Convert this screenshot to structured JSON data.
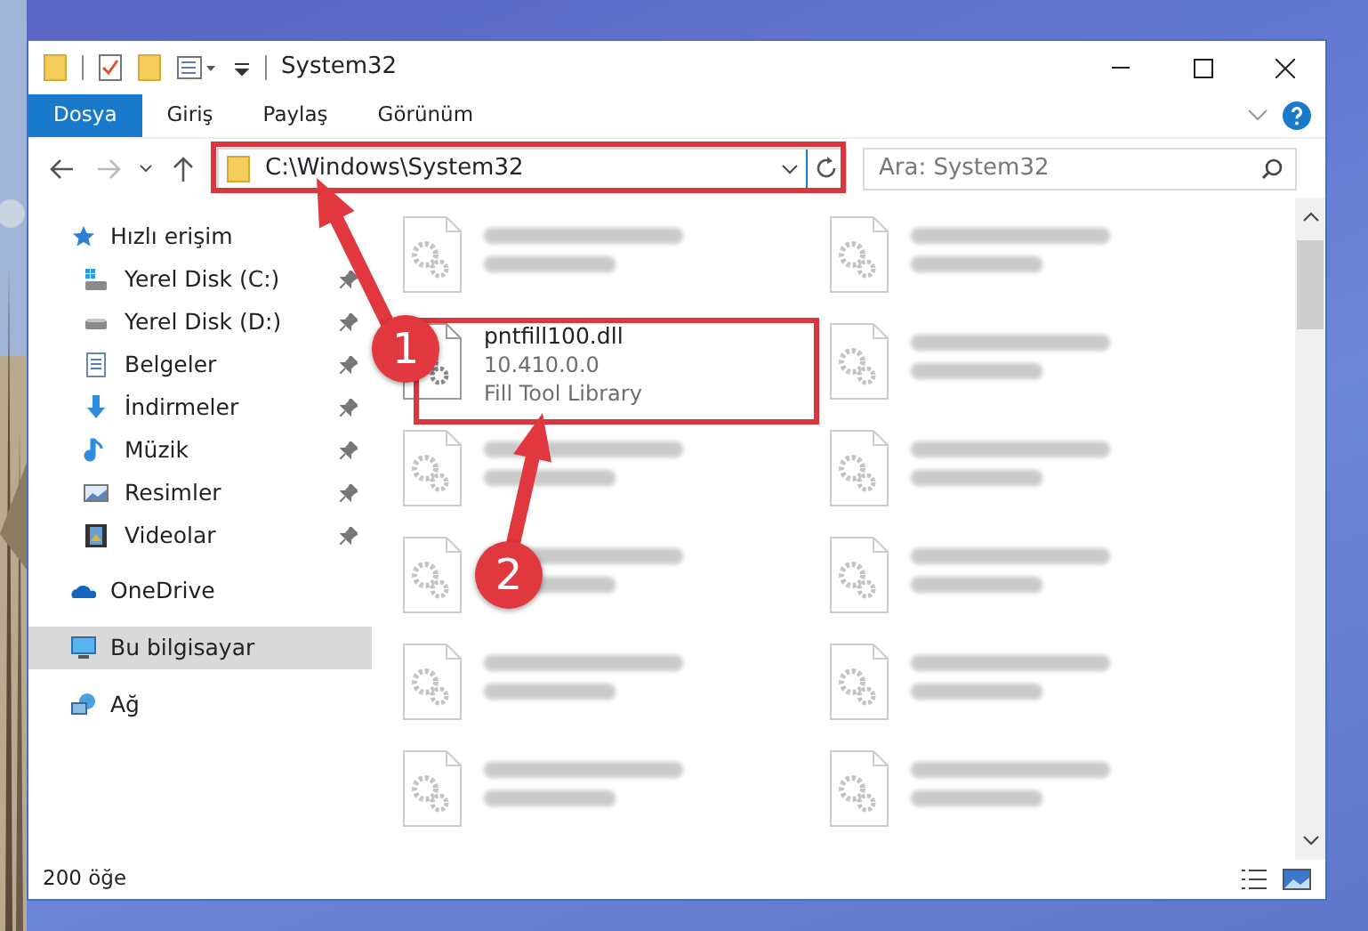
{
  "window": {
    "title": "System32"
  },
  "ribbon_tabs": [
    {
      "label": "Dosya",
      "kind": "file"
    },
    {
      "label": "Giriş",
      "kind": "tab"
    },
    {
      "label": "Paylaş",
      "kind": "tab"
    },
    {
      "label": "Görünüm",
      "kind": "tab"
    }
  ],
  "address": {
    "path": "C:\\Windows\\System32"
  },
  "search": {
    "placeholder": "Ara: System32"
  },
  "sidebar": {
    "items": [
      {
        "label": "Hızlı erişim",
        "selected": false,
        "children": [
          {
            "label": "Yerel Disk (C:)",
            "pinned": true,
            "selected": false
          },
          {
            "label": "Yerel Disk (D:)",
            "pinned": true,
            "selected": false
          },
          {
            "label": "Belgeler",
            "pinned": true,
            "selected": false
          },
          {
            "label": "İndirmeler",
            "pinned": true,
            "selected": false
          },
          {
            "label": "Müzik",
            "pinned": true,
            "selected": false
          },
          {
            "label": "Resimler",
            "pinned": true,
            "selected": false
          },
          {
            "label": "Videolar",
            "pinned": true,
            "selected": false
          }
        ]
      },
      {
        "label": "OneDrive",
        "selected": false
      },
      {
        "label": "Bu bilgisayar",
        "selected": true
      },
      {
        "label": "Ağ",
        "selected": false
      }
    ]
  },
  "files": [
    {
      "kind": "blurred"
    },
    {
      "kind": "blurred"
    },
    {
      "kind": "file",
      "name": "pntfill100.dll",
      "details": [
        "10.410.0.0",
        "Fill Tool Library"
      ]
    },
    {
      "kind": "blurred"
    },
    {
      "kind": "blurred"
    },
    {
      "kind": "blurred"
    },
    {
      "kind": "blurred"
    },
    {
      "kind": "blurred"
    },
    {
      "kind": "blurred"
    },
    {
      "kind": "blurred"
    },
    {
      "kind": "blurred"
    },
    {
      "kind": "blurred"
    }
  ],
  "status_bar": {
    "item_count": "200 öğe"
  },
  "callouts": [
    {
      "label": "1"
    },
    {
      "label": "2"
    }
  ]
}
